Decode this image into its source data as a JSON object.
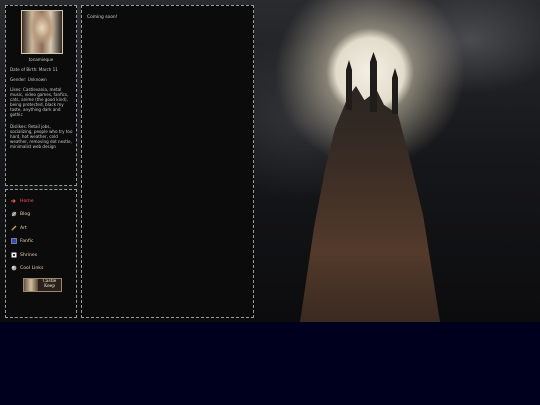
{
  "profile": {
    "nickname": "tonamieque",
    "date_of_birth": "Date of Birth: March 11",
    "gender": "Gender: Unknown",
    "likes": "Likes: Castlevania, metal music, video games, fanfics, cats, anime (the good kind), being protected, black my taste, anything dark and gothic",
    "dislikes": "Dislikes: Retail jobs, socializing, people who try too hard, hot weather, cold weather, removing dot nestle, minimalist web design"
  },
  "nav": {
    "items": [
      {
        "label": "Home",
        "icon": "arrow-icon",
        "color": "#ff5a5a"
      },
      {
        "label": "Blog",
        "icon": "sword-icon",
        "color": "#e8d3b0"
      },
      {
        "label": "Art",
        "icon": "brush-icon",
        "color": "#e8d3b0"
      },
      {
        "label": "Fanfic",
        "icon": "book-icon",
        "color": "#e8d3b0"
      },
      {
        "label": "Shrines",
        "icon": "square-icon",
        "color": "#e8d3b0"
      },
      {
        "label": "Cool Links",
        "icon": "orb-icon",
        "color": "#e8d3b0"
      }
    ],
    "banner_text": "Castle Keep"
  },
  "main": {
    "status_text": "Coming soon!"
  }
}
